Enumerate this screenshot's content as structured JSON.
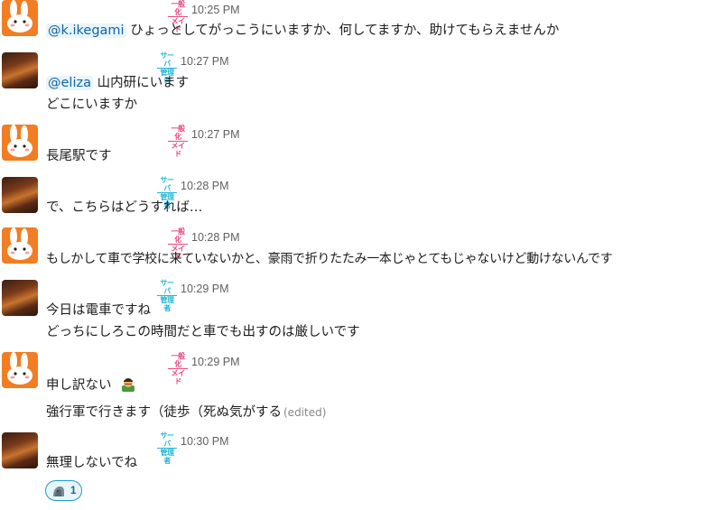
{
  "users": {
    "rabbit": {
      "badge_l1": "一般化",
      "badge_l2": "メイド",
      "color": "#e8457f"
    },
    "photo": {
      "badge_l1": "サーバ",
      "badge_l2": "管理者",
      "color": "#21b6d6"
    }
  },
  "messages": [
    {
      "user": "rabbit",
      "time": "10:25 PM",
      "mention": "@k.ikegami",
      "text": "ひょっとしてがっこうにいますか、何してますか、助けてもらえませんか"
    },
    {
      "user": "photo",
      "time": "10:27 PM",
      "mention": "@eliza",
      "text": "山内研にいます",
      "text2": "どこにいますか"
    },
    {
      "user": "rabbit",
      "time": "10:27 PM",
      "text": "長尾駅です"
    },
    {
      "user": "photo",
      "time": "10:28 PM",
      "text": "で、こちらはどうすれば…"
    },
    {
      "user": "rabbit",
      "time": "10:28 PM",
      "text": "もしかして車で学校に来ていないかと、豪雨で折りたたみ一本じゃとてもじゃないけど動けないんです"
    },
    {
      "user": "photo",
      "time": "10:29 PM",
      "text": "今日は電車ですね",
      "text2": "どっちにしろこの時間だと車でも出すのは厳しいです"
    },
    {
      "user": "rabbit",
      "time": "10:29 PM",
      "text": "申し訳ない",
      "emoji": "person-bowing-emoji",
      "text2": "強行軍で行きます（徒歩（死ぬ気がする",
      "edited": "(edited)"
    },
    {
      "user": "photo",
      "time": "10:30 PM",
      "text": "無理しないでね"
    }
  ],
  "reaction": {
    "icon": "stone-statue-reaction-icon",
    "count": "1"
  }
}
